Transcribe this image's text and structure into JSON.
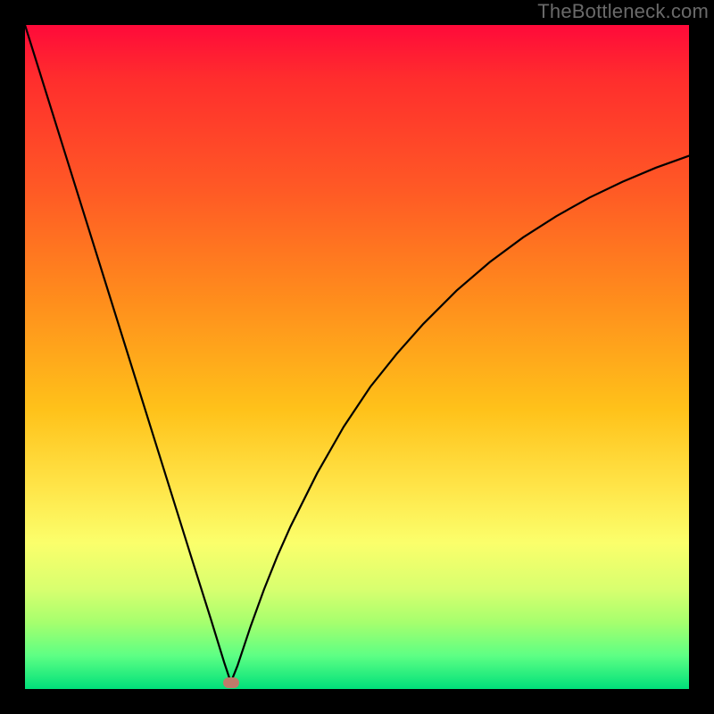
{
  "watermark": "TheBottleneck.com",
  "colors": {
    "marker": "#c07a6a",
    "curve": "#000000"
  },
  "chart_data": {
    "type": "line",
    "title": "",
    "xlabel": "",
    "ylabel": "",
    "xlim": [
      0,
      100
    ],
    "ylim": [
      0,
      100
    ],
    "grid": false,
    "legend": false,
    "marker": {
      "x": 31,
      "y": 1
    },
    "annotations": [],
    "description": "V-shaped bottleneck curve: steep linear drop from top-left to a minimum near x≈31, then a concave rise approaching the top-right.",
    "series": [
      {
        "name": "bottleneck-curve",
        "x": [
          0,
          5,
          10,
          15,
          20,
          25,
          28,
          30,
          31,
          32,
          34,
          36,
          38,
          40,
          44,
          48,
          52,
          56,
          60,
          65,
          70,
          75,
          80,
          85,
          90,
          95,
          100
        ],
        "values": [
          100,
          84,
          68,
          52,
          36,
          20,
          10.5,
          4.0,
          1.0,
          3.5,
          9.5,
          15.0,
          20.0,
          24.5,
          32.5,
          39.5,
          45.5,
          50.5,
          55.0,
          60.0,
          64.3,
          68.0,
          71.2,
          74.0,
          76.4,
          78.5,
          80.3
        ]
      }
    ]
  }
}
